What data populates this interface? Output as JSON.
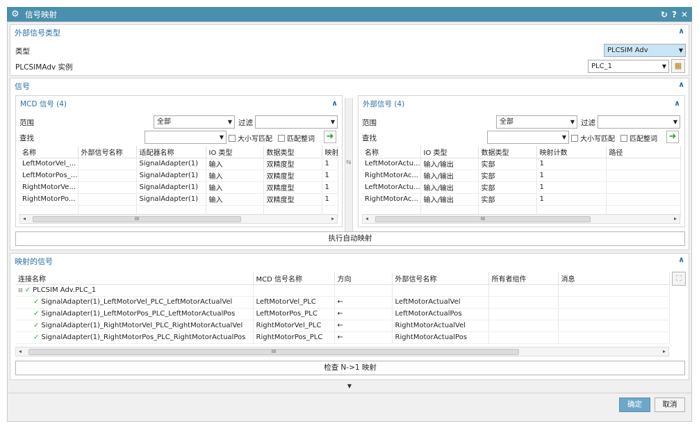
{
  "title": "信号映射",
  "title_controls": [
    "↻",
    "?",
    "✕"
  ],
  "ext_type_section": {
    "title": "外部信号类型",
    "type_label": "类型",
    "type_value": "PLCSIM Adv",
    "instance_label": "PLCSIMAdv 实例",
    "instance_value": "PLC_1"
  },
  "signals_section": {
    "title": "信号",
    "mcd": {
      "title": "MCD 信号 (4)",
      "scope_label": "范围",
      "scope_value": "全部",
      "filter_label": "过滤",
      "find_label": "查找",
      "case_label": "大小写匹配",
      "whole_label": "匹配整词",
      "columns": [
        "名称",
        "外部信号名称",
        "适配器名称",
        "IO 类型",
        "数据类型",
        "映射"
      ],
      "rows": [
        [
          "LeftMotorVel_...",
          "",
          "SignalAdapter(1)",
          "输入",
          "双精度型",
          "1"
        ],
        [
          "LeftMotorPos_...",
          "",
          "SignalAdapter(1)",
          "输入",
          "双精度型",
          "1"
        ],
        [
          "RightMotorVe...",
          "",
          "SignalAdapter(1)",
          "输入",
          "双精度型",
          "1"
        ],
        [
          "RightMotorPo...",
          "",
          "SignalAdapter(1)",
          "输入",
          "双精度型",
          "1"
        ]
      ]
    },
    "ext": {
      "title": "外部信号 (4)",
      "scope_label": "范围",
      "scope_value": "全部",
      "filter_label": "过滤",
      "find_label": "查找",
      "case_label": "大小写匹配",
      "whole_label": "匹配整词",
      "columns": [
        "名称",
        "IO 类型",
        "数据类型",
        "映射计数",
        "路径"
      ],
      "rows": [
        [
          "LeftMotorActu...",
          "输入/输出",
          "实部",
          "1",
          ""
        ],
        [
          "RightMotorAc...",
          "输入/输出",
          "实部",
          "1",
          ""
        ],
        [
          "LeftMotorActu...",
          "输入/输出",
          "实部",
          "1",
          ""
        ],
        [
          "RightMotorAc...",
          "输入/输出",
          "实部",
          "1",
          ""
        ]
      ]
    },
    "auto_map_label": "执行自动映射"
  },
  "mapped_section": {
    "title": "映射的信号",
    "columns": [
      "连接名称",
      "MCD 信号名称",
      "方向",
      "外部信号名称",
      "所有者组件",
      "消息"
    ],
    "root_label": "PLCSIM Adv.PLC_1",
    "rows": [
      [
        "SignalAdapter(1)_LeftMotorVel_PLC_LeftMotorActualVel",
        "LeftMotorVel_PLC",
        "←",
        "LeftMotorActualVel",
        "",
        ""
      ],
      [
        "SignalAdapter(1)_LeftMotorPos_PLC_LeftMotorActualPos",
        "LeftMotorPos_PLC",
        "←",
        "LeftMotorActualPos",
        "",
        ""
      ],
      [
        "SignalAdapter(1)_RightMotorVel_PLC_RightMotorActualVel",
        "RightMotorVel_PLC",
        "←",
        "RightMotorActualVel",
        "",
        ""
      ],
      [
        "SignalAdapter(1)_RightMotorPos_PLC_RightMotorActualPos",
        "RightMotorPos_PLC",
        "←",
        "RightMotorActualPos",
        "",
        ""
      ]
    ],
    "check_label": "检查 N->1 映射"
  },
  "footer": {
    "ok_label": "确定",
    "cancel_label": "取消"
  },
  "scroll_grip": "III",
  "colors": {
    "title_bg": "#4a8fad",
    "section_title": "#2a6fa8",
    "ok_bg": "#6fa8c7"
  }
}
